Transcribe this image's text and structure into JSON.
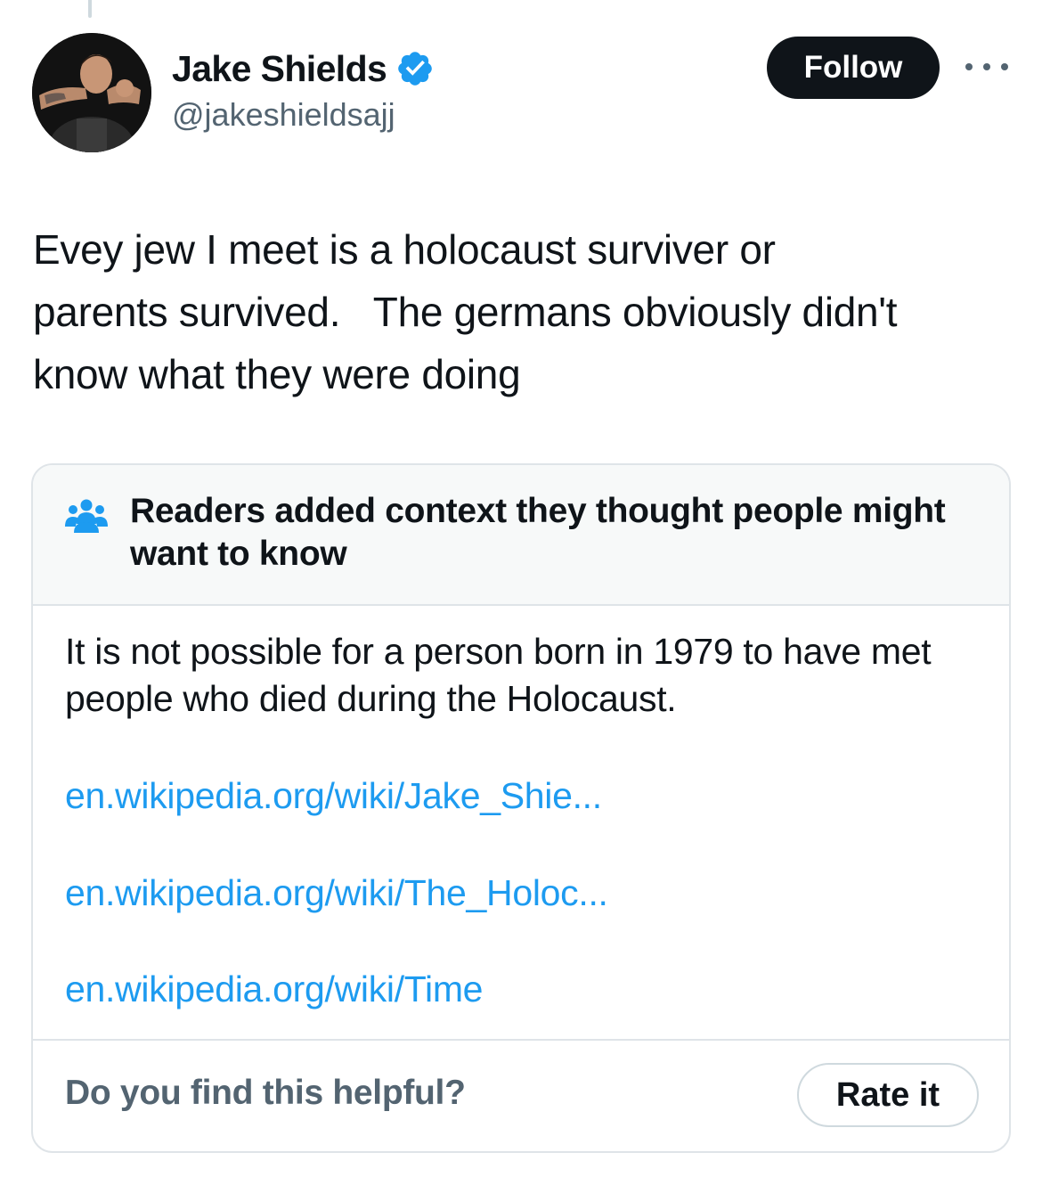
{
  "tweet": {
    "author": {
      "display_name": "Jake Shields",
      "handle": "@jakeshieldsajj",
      "verified": true
    },
    "follow_label": "Follow",
    "more_icon": "more-horizontal-icon",
    "text": "Evey jew I meet is a holocaust surviver or\nparents survived.   The germans obviously didn't\nknow what they were doing"
  },
  "community_note": {
    "header": "Readers added context they thought people might want to know",
    "header_icon": "people-group-icon",
    "body": "It is not possible for a person born in 1979 to have met people who died during the Holocaust.",
    "links": [
      "en.wikipedia.org/wiki/Jake_Shie...",
      "en.wikipedia.org/wiki/The_Holoc...",
      "en.wikipedia.org/wiki/Time"
    ],
    "helpful_question": "Do you find this helpful?",
    "rate_label": "Rate it"
  },
  "colors": {
    "text_primary": "#0f1419",
    "text_secondary": "#536471",
    "link": "#1d9bf0",
    "verified_badge": "#1d9bf0",
    "border": "#dfe4e8",
    "note_header_bg": "#f7f9f9",
    "follow_bg": "#0f1419"
  }
}
